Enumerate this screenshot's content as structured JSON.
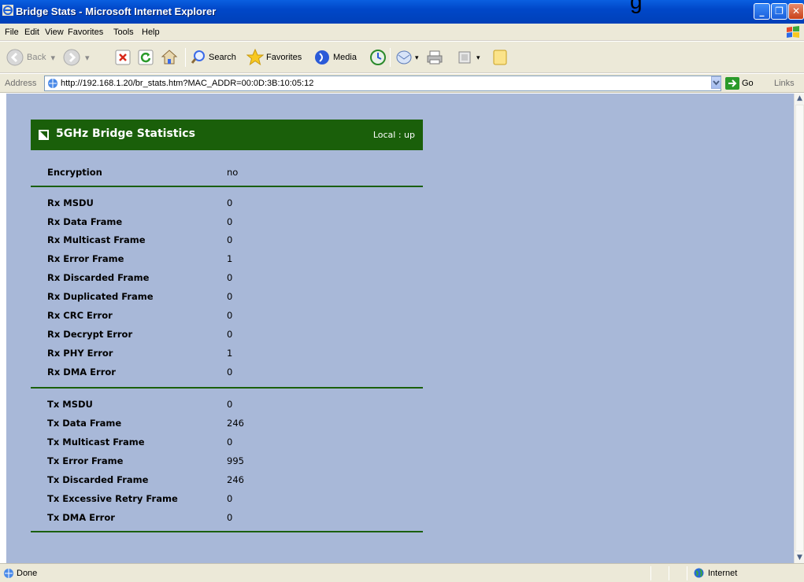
{
  "window": {
    "title": "Bridge Stats - Microsoft Internet Explorer",
    "clipped_text": "g"
  },
  "menu": {
    "items": [
      "File",
      "Edit",
      "View",
      "Favorites",
      "Tools",
      "Help"
    ]
  },
  "toolbar": {
    "back_label": "Back",
    "search_label": "Search",
    "favorites_label": "Favorites",
    "media_label": "Media"
  },
  "address": {
    "label": "Address",
    "url": "http://192.168.1.20/br_stats.htm?MAC_ADDR=00:0D:3B:10:05:12",
    "go_label": "Go",
    "links_label": "Links"
  },
  "panel": {
    "title": "5GHz Bridge Statistics",
    "status": "Local : up",
    "header_color": "#1a5f0a",
    "background_color": "#a8b8d8"
  },
  "stats": {
    "general": [
      {
        "label": "Encryption",
        "value": "no"
      }
    ],
    "rx": [
      {
        "label": "Rx MSDU",
        "value": "0"
      },
      {
        "label": "Rx Data Frame",
        "value": "0"
      },
      {
        "label": "Rx Multicast Frame",
        "value": "0"
      },
      {
        "label": "Rx Error Frame",
        "value": "1"
      },
      {
        "label": "Rx Discarded Frame",
        "value": "0"
      },
      {
        "label": "Rx Duplicated Frame",
        "value": "0"
      },
      {
        "label": "Rx CRC Error",
        "value": "0"
      },
      {
        "label": "Rx Decrypt Error",
        "value": "0"
      },
      {
        "label": "Rx PHY Error",
        "value": "1"
      },
      {
        "label": "Rx DMA Error",
        "value": "0"
      }
    ],
    "tx": [
      {
        "label": "Tx MSDU",
        "value": "0"
      },
      {
        "label": "Tx Data Frame",
        "value": "246"
      },
      {
        "label": "Tx Multicast Frame",
        "value": "0"
      },
      {
        "label": "Tx Error Frame",
        "value": "995"
      },
      {
        "label": "Tx Discarded Frame",
        "value": "246"
      },
      {
        "label": "Tx Excessive Retry Frame",
        "value": "0"
      },
      {
        "label": "Tx DMA Error",
        "value": "0"
      }
    ]
  },
  "status_bar": {
    "text": "Done",
    "zone": "Internet"
  }
}
